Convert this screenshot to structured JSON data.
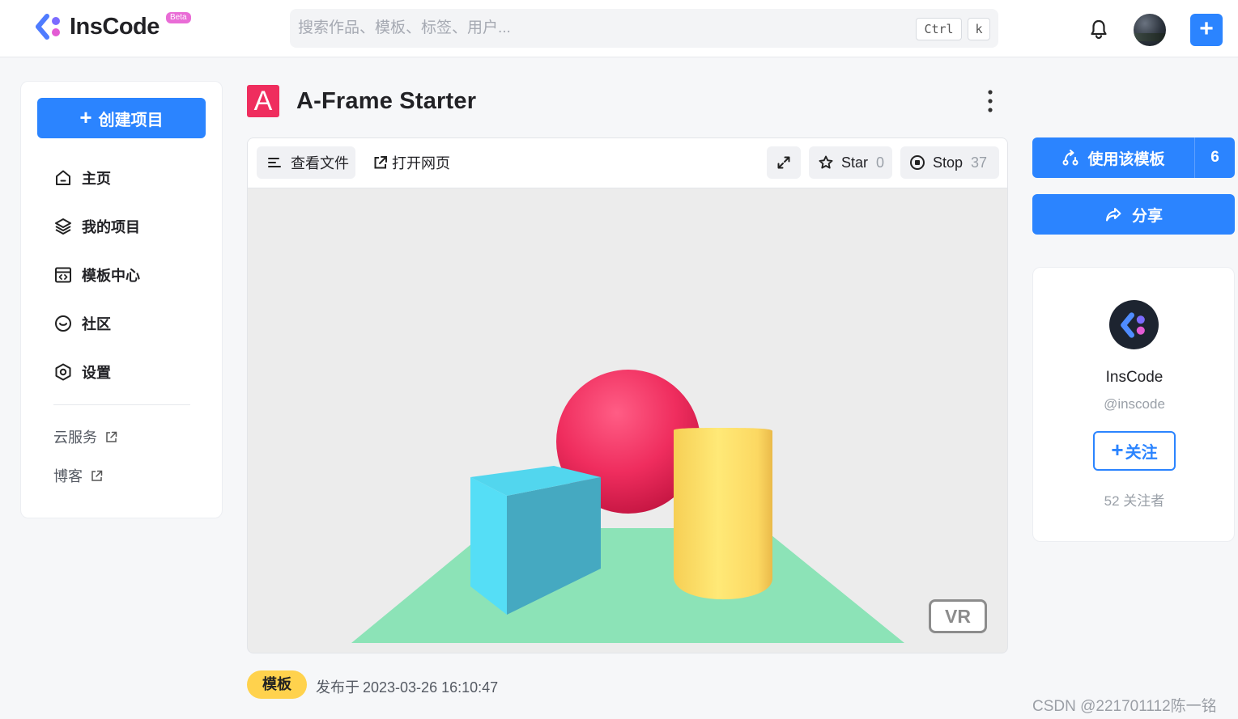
{
  "app": {
    "name": "InsCode",
    "badge": "Beta",
    "brand_color": "#2b84ff"
  },
  "header": {
    "search_placeholder": "搜索作品、模板、标签、用户...",
    "shortcut_ctrl": "Ctrl",
    "shortcut_key": "k",
    "icons": [
      "bell-icon",
      "avatar",
      "plus-icon"
    ]
  },
  "sidebar": {
    "create_label": "创建项目",
    "items": [
      {
        "label": "主页",
        "icon": "home-icon"
      },
      {
        "label": "我的项目",
        "icon": "layers-icon"
      },
      {
        "label": "模板中心",
        "icon": "template-icon"
      },
      {
        "label": "社区",
        "icon": "community-icon"
      },
      {
        "label": "设置",
        "icon": "settings-icon"
      }
    ],
    "links": [
      {
        "label": "云服务",
        "icon": "external-link-icon"
      },
      {
        "label": "博客",
        "icon": "external-link-icon"
      }
    ]
  },
  "project": {
    "icon_letter": "A",
    "icon_color": "#ef2d5e",
    "title": "A-Frame Starter",
    "toolbar": {
      "view_files": "查看文件",
      "open_page": "打开网页",
      "star_label": "Star",
      "star_count": "0",
      "stop_label": "Stop",
      "stop_count": "37"
    },
    "vr_label": "VR",
    "tag": "模板",
    "published_label": "发布于",
    "published_time": "2023-03-26 16:10:47"
  },
  "actions": {
    "use_template": "使用该模板",
    "use_count": "6",
    "share": "分享"
  },
  "author": {
    "name": "InsCode",
    "handle": "@inscode",
    "follow": "关注",
    "followers": "52 关注者"
  },
  "watermark": "CSDN @221701112陈一铭"
}
